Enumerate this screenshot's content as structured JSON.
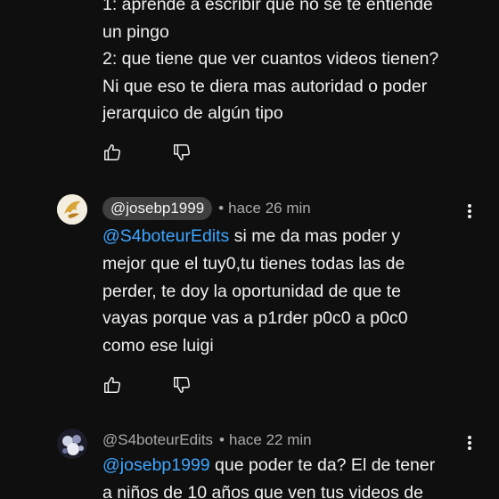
{
  "comment_prev": {
    "lines": [
      "1: aprende a escribir que no se te entiende",
      "un pingo",
      "2: que tiene que ver cuantos videos tienen?",
      "Ni que eso te diera mas autoridad o poder",
      "jerarquico de algún tipo"
    ]
  },
  "comment_josebp": {
    "handle": "@josebp1999",
    "time": "hace 26 min",
    "mention": "@S4boteurEdits",
    "lines": [
      " si me da mas poder y",
      "mejor que el tuy0,tu tienes todas las de",
      "perder, te doy la oportunidad de que te",
      "vayas porque vas a p1rder p0c0 a p0c0",
      "como ese luigi"
    ]
  },
  "comment_s4boteur": {
    "handle": "@S4boteurEdits",
    "time": "hace 22 min",
    "mention": "@josebp1999",
    "lines": [
      " que poder te da? El de tener",
      "a niños de 10 años que ven tus videos de"
    ]
  },
  "separator": "•",
  "icons": {
    "like": "thumbs-up-icon",
    "dislike": "thumbs-down-icon",
    "more": "more-vert-icon"
  },
  "colors": {
    "background": "#0f0f0f",
    "text": "#f1f1f1",
    "secondary": "#aaaaaa",
    "mention": "#3ea6ff",
    "pill": "#3f3f3f"
  }
}
